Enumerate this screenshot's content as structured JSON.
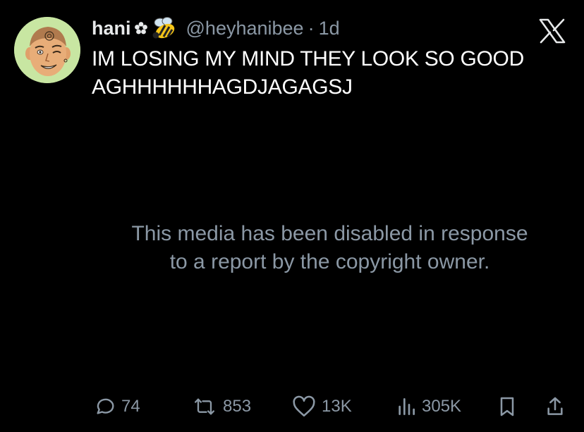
{
  "tweet": {
    "display_name": "hani",
    "name_emojis": [
      "flower-icon",
      "bee-icon"
    ],
    "handle": "@heyhanibee",
    "separator": "·",
    "time": "1d",
    "text_lines": [
      "IM LOSING MY MIND THEY LOOK SO GOOD",
      "AGHHHHHHAGDJAGAGSJ"
    ],
    "media_notice_lines": [
      "This media has been disabled in response",
      "to a report by the copyright owner."
    ]
  },
  "actions": {
    "replies": "74",
    "reposts": "853",
    "likes": "13K",
    "views": "305K"
  },
  "colors": {
    "background": "#000000",
    "text": "#ffffff",
    "secondary": "#8b98a5",
    "avatar_bg": "#c8e6a2"
  }
}
